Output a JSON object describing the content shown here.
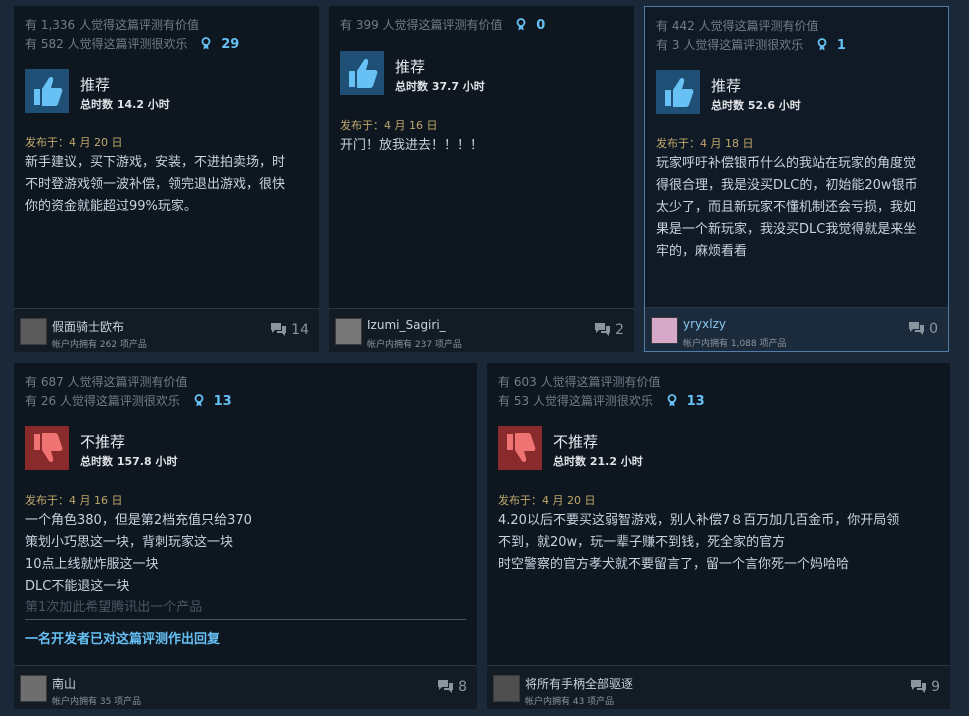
{
  "reviews": [
    {
      "helpful": "有 1,336 人觉得这篇评测有价值",
      "funny": "有 582 人觉得这篇评测很欢乐",
      "awards": "29",
      "verdict": "推荐",
      "hours": "总时数 14.2 小时",
      "posted": "发布于：4 月 20 日",
      "text": [
        "新手建议，买下游戏，安装，不进拍卖场，时",
        "不时登游戏领一波补偿，领完退出游戏，很快",
        "你的资金就能超过99%玩家。"
      ],
      "username": "假面骑士欧布",
      "owned": "帐户内拥有 262 项产品",
      "comments": "14"
    },
    {
      "helpful": "有 399 人觉得这篇评测有价值",
      "awards": "0",
      "verdict": "推荐",
      "hours": "总时数 37.7 小时",
      "posted": "发布于：4 月 16 日",
      "text": [
        "开门！放我进去！！！！"
      ],
      "username": "Izumi_Sagiri_",
      "owned": "帐户内拥有 237 项产品",
      "comments": "2"
    },
    {
      "helpful": "有 442 人觉得这篇评测有价值",
      "funny": "有 3 人觉得这篇评测很欢乐",
      "awards": "1",
      "verdict": "推荐",
      "hours": "总时数 52.6 小时",
      "posted": "发布于：4 月 18 日",
      "text": [
        "玩家呼吁补偿银币什么的我站在玩家的角度觉",
        "得很合理，我是没买DLC的，初始能20w银币",
        "太少了，而且新玩家不懂机制还会亏损，我如",
        "果是一个新玩家，我没买DLC我觉得就是来坐",
        "牢的，麻烦看看"
      ],
      "username": "yryxlzy",
      "owned": "帐户内拥有 1,088 项产品",
      "comments": "0"
    },
    {
      "helpful": "有 687 人觉得这篇评测有价值",
      "funny": "有 26 人觉得这篇评测很欢乐",
      "awards": "13",
      "verdict": "不推荐",
      "hours": "总时数 157.8 小时",
      "posted": "发布于：4 月 16 日",
      "text": [
        "一个角色380，但是第2档充值只给370",
        "策划小巧思这一块，背刺玩家这一块",
        "10点上线就炸服这一块",
        "DLC不能退这一块"
      ],
      "text_faded": "第1次加此希望腾讯出一个产品",
      "dev_reply": "一名开发者已对这篇评测作出回复",
      "username": "南山",
      "owned": "帐户内拥有 35 项产品",
      "comments": "8"
    },
    {
      "helpful": "有 603 人觉得这篇评测有价值",
      "funny": "有 53 人觉得这篇评测很欢乐",
      "awards": "13",
      "verdict": "不推荐",
      "hours": "总时数 21.2 小时",
      "posted": "发布于：4 月 20 日",
      "text": [
        "4.20以后不要买这弱智游戏，别人补偿7８百万加几百金币，你开局领",
        "不到，就20w，玩一辈子赚不到钱，死全家的官方",
        "时空警察的官方孝犬就不要留言了，留一个言你死一个妈哈哈"
      ],
      "username": "将所有手柄全部驱逐",
      "owned": "帐户内拥有 43 项产品",
      "comments": "9"
    }
  ]
}
